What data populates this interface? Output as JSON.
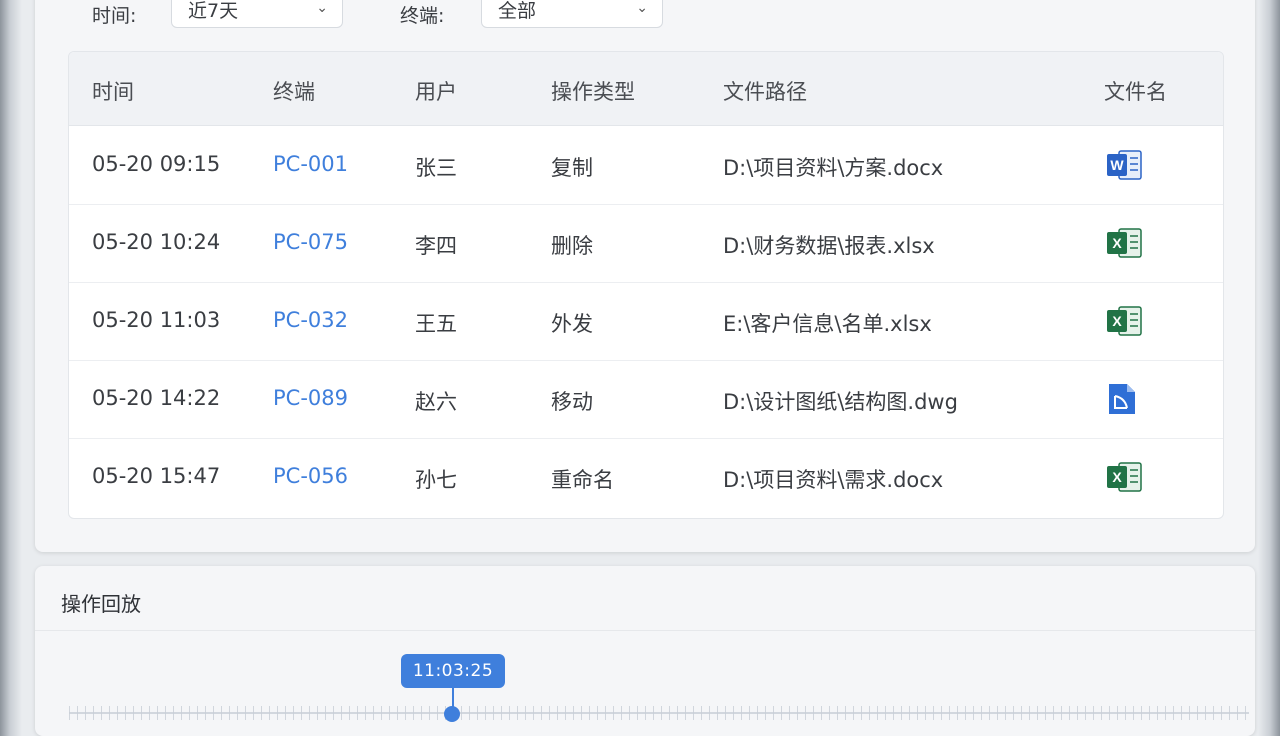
{
  "filters": {
    "time_label": "时间:",
    "time_value": "近7天",
    "terminal_label": "终端:",
    "terminal_value": "全部"
  },
  "table": {
    "headers": [
      "时间",
      "终端",
      "用户",
      "操作类型",
      "文件路径",
      "文件名"
    ],
    "rows": [
      {
        "time": "05-20 09:15",
        "terminal": "PC-001",
        "user": "张三",
        "op": "复制",
        "path": "D:\\项目资料\\方案.docx",
        "icon": "word-file-icon"
      },
      {
        "time": "05-20 10:24",
        "terminal": "PC-075",
        "user": "李四",
        "op": "删除",
        "path": "D:\\财务数据\\报表.xlsx",
        "icon": "excel-file-icon"
      },
      {
        "time": "05-20 11:03",
        "terminal": "PC-032",
        "user": "王五",
        "op": "外发",
        "path": "E:\\客户信息\\名单.xlsx",
        "icon": "excel-file-icon"
      },
      {
        "time": "05-20 14:22",
        "terminal": "PC-089",
        "user": "赵六",
        "op": "移动",
        "path": "D:\\设计图纸\\结构图.dwg",
        "icon": "cad-file-icon"
      },
      {
        "time": "05-20 15:47",
        "terminal": "PC-056",
        "user": "孙七",
        "op": "重命名",
        "path": "D:\\项目资料\\需求.docx",
        "icon": "excel-file-icon"
      }
    ]
  },
  "playback": {
    "title": "操作回放",
    "current_time": "11:03:25"
  },
  "colors": {
    "accent": "#3f7fdc",
    "word": "#2b63c6",
    "excel": "#217346",
    "cad": "#2f6fd6"
  }
}
